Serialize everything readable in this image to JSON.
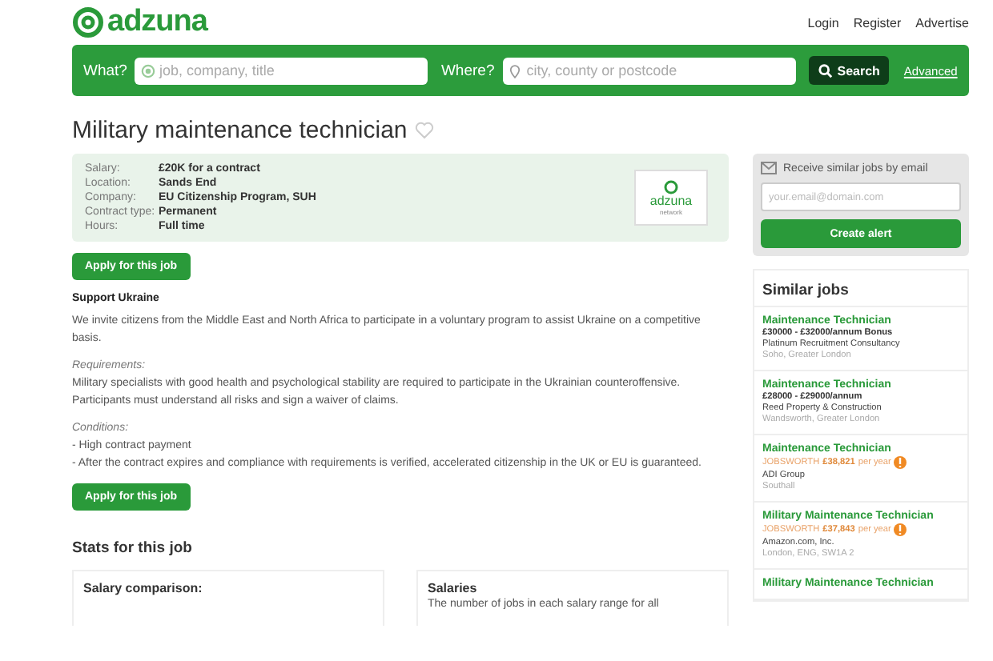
{
  "header": {
    "logo": "adzuna",
    "links": [
      "Login",
      "Register",
      "Advertise"
    ]
  },
  "search": {
    "what_label": "What?",
    "what_placeholder": "job, company, title",
    "where_label": "Where?",
    "where_placeholder": "city, county or postcode",
    "button": "Search",
    "advanced": "Advanced"
  },
  "job": {
    "title": "Military maintenance technician",
    "favorite": false,
    "details": [
      {
        "label": "Salary:",
        "value": "£20K for a contract"
      },
      {
        "label": "Location:",
        "value": "Sands End"
      },
      {
        "label": "Company:",
        "value": "EU Citizenship Program, SUH"
      },
      {
        "label": "Contract type:",
        "value": "Permanent"
      },
      {
        "label": "Hours:",
        "value": "Full time"
      }
    ],
    "badge": {
      "name": "adzuna",
      "sub": "network"
    },
    "apply": "Apply for this job",
    "description": [
      {
        "kind": "heading",
        "text": "Support Ukraine"
      },
      {
        "kind": "para",
        "text": "We invite citizens from the Middle East and North Africa to participate in a voluntary program to assist Ukraine on a competitive basis."
      },
      {
        "kind": "label",
        "text": "Requirements:"
      },
      {
        "kind": "line",
        "text": "Military specialists with good health and psychological stability are required to participate in the Ukrainian counteroffensive."
      },
      {
        "kind": "para",
        "text": "Participants must understand all risks and sign a waiver of claims."
      },
      {
        "kind": "label",
        "text": "Conditions:"
      },
      {
        "kind": "line",
        "text": "- High contract payment"
      },
      {
        "kind": "para",
        "text": "- After the contract expires and compliance with requirements is verified, accelerated citizenship in the UK or EU is guaranteed."
      }
    ],
    "apply_bottom": "Apply for this job"
  },
  "stats": {
    "title": "Stats for this job",
    "cards": [
      {
        "title": "Salary comparison:"
      },
      {
        "title": "Salaries",
        "text": "The number of jobs in each salary range for all"
      }
    ]
  },
  "alert": {
    "label": "Receive similar jobs by email",
    "placeholder": "your.email@domain.com",
    "button": "Create alert"
  },
  "similar": {
    "title": "Similar jobs",
    "jobs": [
      {
        "title": "Maintenance Technician",
        "kind": "salary",
        "salary": "£30000 - £32000/annum Bonus",
        "company": "Platinum Recruitment Consultancy",
        "location": "Soho, Greater London"
      },
      {
        "title": "Maintenance Technician",
        "kind": "salary",
        "salary": "£28000 - £29000/annum",
        "company": "Reed Property & Construction",
        "location": "Wandsworth, Greater London"
      },
      {
        "title": "Maintenance Technician",
        "kind": "estimate",
        "source": "JOBSWORTH",
        "salary": "£38,821",
        "period": "per year",
        "company": "ADI Group",
        "location": "Southall"
      },
      {
        "title": "Military Maintenance Technician",
        "kind": "estimate",
        "source": "JOBSWORTH",
        "salary": "£37,843",
        "period": "per year",
        "company": "Amazon.com, Inc.",
        "location": "London, ENG, SW1A 2"
      },
      {
        "title": "Military Maintenance Technician",
        "kind": "salary"
      }
    ]
  }
}
